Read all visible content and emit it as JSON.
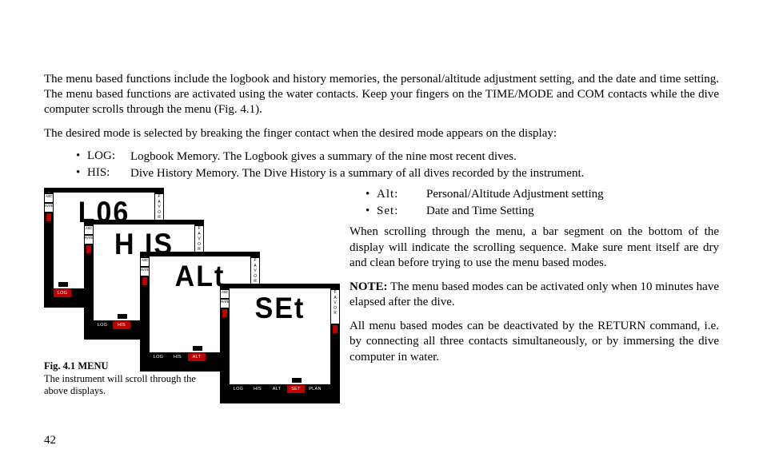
{
  "para1": "The menu based functions include the logbook and history memories, the personal/altitude adjustment setting, and the date and time setting. The menu based functions are activated using the water contacts. Keep your fingers on the TIME/MODE and COM contacts while the dive computer scrolls through the menu (Fig. 4.1).",
  "para2": "The desired mode is selected by breaking the finger contact when the desired mode appears on the display:",
  "modes": {
    "log_key": "LOG:",
    "log_desc": "Logbook  Memory. The Logbook gives a summary of the nine most recent dives.",
    "his_key": "HIS:",
    "his_desc": "Dive History Memory. The Dive History is a summary of all dives recorded by the instrument."
  },
  "right": {
    "alt_key": "Alt:",
    "alt_desc": "Personal/Altitude Adjustment setting",
    "set_key": "Set:",
    "set_desc": "Date and Time Setting",
    "p1": "When scrolling through the menu, a bar segment on the bottom of the display will indicate the scrolling sequence. Make sure ment itself are dry and clean before trying to use the menu based modes.",
    "note_label": "NOTE:",
    "note_body": " The menu based modes can be activated only when 10 minutes have elapsed after the dive.",
    "p2": "All menu based modes can be deactivated by the RETURN command, i.e. by connecting all three contacts simultaneously, or by immersing the dive computer in water."
  },
  "caption": {
    "title": "Fig. 4.1 MENU",
    "body": "The instrument will scroll through the above displays."
  },
  "page_number": "42",
  "devices": [
    {
      "seg": "L06",
      "menu": [
        "LOG"
      ],
      "active": 0
    },
    {
      "seg": "H IS",
      "menu": [
        "LOG",
        "HIS"
      ],
      "active": 1
    },
    {
      "seg": "ALt",
      "menu": [
        "LOG",
        "HIS",
        "ALT"
      ],
      "active": 2
    },
    {
      "seg": "SEt",
      "menu": [
        "LOG",
        "HIS",
        "ALT",
        "SET",
        "PLAN"
      ],
      "active": 3
    }
  ],
  "side_labels": {
    "asc": "ASC",
    "rate": "RATE",
    "favor": "FAVOR"
  }
}
